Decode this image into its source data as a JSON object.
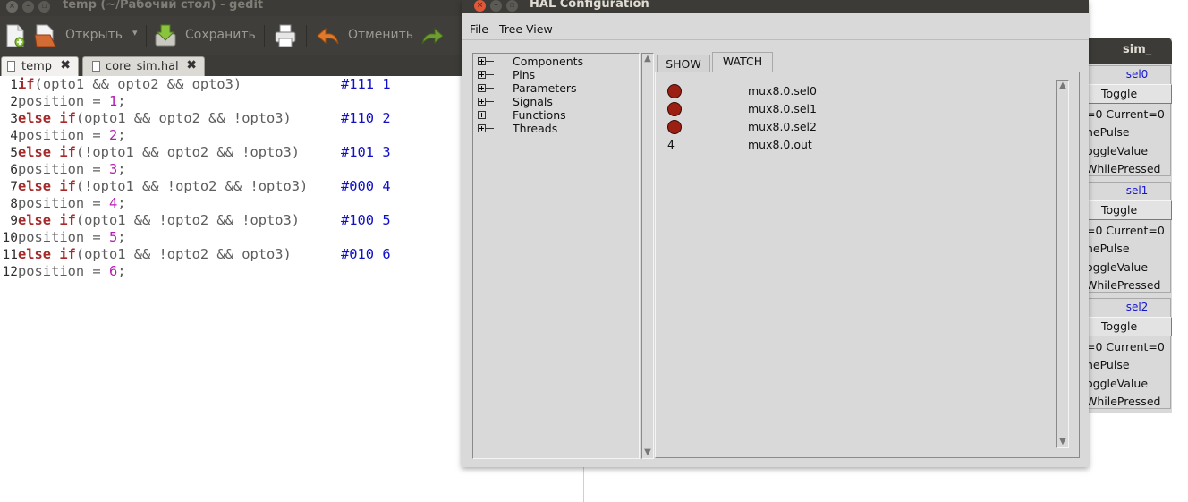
{
  "gedit": {
    "title": "temp (~/Рабочий стол) - gedit",
    "toolbar": {
      "open_label": "Открыть",
      "save_label": "Сохранить",
      "undo_label": "Отменить"
    },
    "tabs": [
      {
        "label": "temp",
        "active": true
      },
      {
        "label": "core_sim.hal",
        "active": false
      }
    ],
    "editor": {
      "lines": [
        {
          "n": "1"
        },
        {
          "n": "2"
        },
        {
          "n": "3"
        },
        {
          "n": "4"
        },
        {
          "n": "5"
        },
        {
          "n": "6"
        },
        {
          "n": "7"
        },
        {
          "n": "8"
        },
        {
          "n": "9"
        },
        {
          "n": "10"
        },
        {
          "n": "11"
        },
        {
          "n": "12"
        }
      ],
      "kw_if": "if",
      "kw_else_if": "else if",
      "conds": [
        "(opto1 && opto2 && opto3)",
        "(opto1 && opto2 && !opto3)",
        "(!opto1 && opto2 && !opto3)",
        "(!opto1 && !opto2 && !opto3)",
        "(opto1 && !opto2 && !opto3)",
        "(opto1 && !opto2 && opto3)"
      ],
      "comments": [
        "#111 1",
        "#110 2",
        "#101 3",
        "#000 4",
        "#100 5",
        "#010 6"
      ],
      "assign_prefix": "position = ",
      "values": [
        "1",
        "2",
        "3",
        "4",
        "5",
        "6"
      ],
      "semicolon": ";"
    }
  },
  "hal": {
    "title": "HAL Configuration",
    "menu": {
      "file": "File",
      "tree_view": "Tree View"
    },
    "tree": [
      "Components",
      "Pins",
      "Parameters",
      "Signals",
      "Functions",
      "Threads"
    ],
    "tabs": {
      "show": "SHOW",
      "watch": "WATCH"
    },
    "watch": [
      {
        "type": "led",
        "name": "mux8.0.sel0"
      },
      {
        "type": "led",
        "name": "mux8.0.sel1"
      },
      {
        "type": "led",
        "name": "mux8.0.sel2"
      },
      {
        "type": "value",
        "value": "4",
        "name": "mux8.0.out"
      }
    ],
    "led_color": "#9b1f12"
  },
  "sim": {
    "title": "sim_",
    "groups": [
      {
        "label": "sel0",
        "button": "Toggle",
        "status": "=0 Current=0",
        "opts": [
          "nePulse",
          "oggleValue",
          "WhilePressed"
        ]
      },
      {
        "label": "sel1",
        "button": "Toggle",
        "status": "=0 Current=0",
        "opts": [
          "nePulse",
          "oggleValue",
          "WhilePressed"
        ]
      },
      {
        "label": "sel2",
        "button": "Toggle",
        "status": "=0 Current=0",
        "opts": [
          "nePulse",
          "oggleValue",
          "WhilePressed"
        ]
      }
    ]
  }
}
